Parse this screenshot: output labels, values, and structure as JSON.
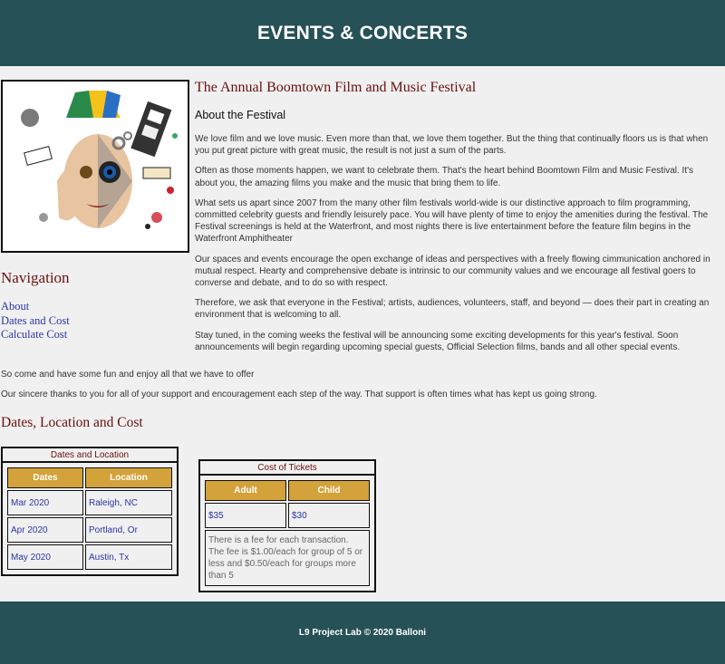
{
  "header": {
    "title": "EVENTS & CONCERTS"
  },
  "hero": {
    "image_label": "Festival collage"
  },
  "navigation": {
    "title": "Navigation",
    "links": [
      "About",
      "Dates and Cost",
      "Calculate Cost"
    ]
  },
  "main": {
    "title": "The Annual Boomtown Film and Music Festival",
    "subtitle": "About the Festival",
    "paragraphs": [
      "We love film and we love music. Even more than that, we love them together. But the thing that continually floors us is that when you put great picture with great music, the result is not just a sum of the parts.",
      "Often as those moments happen, we want to celebrate them. That's the heart behind Boomtown Film and Music Festival. It's about you, the amazing films you make and the music that bring them to life.",
      "What sets us apart since 2007 from the many other film festivals world-wide is our distinctive approach to film programming, committed celebrity guests and friendly leisurely pace. You will have plenty of time to enjoy the amenities during the festival. The Festival screenings is held at the Waterfront, and most nights there is live entertainment before the feature film begins in the Waterfront Amphitheater",
      "Our spaces and events encourage the open exchange of ideas and perspectives with a freely flowing cimmunication anchored in mutual respect. Hearty and comprehensive debate is intrinsic to our community values and we encourage all festival goers to converse and debate, and to do so with respect.",
      "Therefore, we ask that everyone in the Festival; artists, audiences, volunteers, staff, and beyond — does their part in creating an environment that is welcoming to all.",
      "Stay tuned, in the coming weeks the festival will be announcing some exciting developments for this year's festival. Soon announcements will begin regarding upcoming special guests, Official Selection films, bands and all other special events."
    ]
  },
  "outro": [
    "So come and have some fun and enjoy all that we have to offer",
    "Our sincere thanks to you for all of your support and encouragement each step of the way. That support is often times what has kept us going strong."
  ],
  "dates_section": {
    "title": "Dates, Location and Cost",
    "location_table": {
      "caption": "Dates and Location",
      "headers": [
        "Dates",
        "Location"
      ],
      "rows": [
        [
          "Mar 2020",
          "Raleigh, NC"
        ],
        [
          "Apr 2020",
          "Portland, Or"
        ],
        [
          "May 2020",
          "Austin, Tx"
        ]
      ]
    },
    "cost_table": {
      "caption": "Cost of Tickets",
      "headers": [
        "Adult",
        "Child"
      ],
      "prices": [
        "$35",
        "$30"
      ],
      "fee_note": "There is a fee for each transaction. The fee is $1.00/each for group of 5 or less and $0.50/each for groups more than 5"
    }
  },
  "footer": {
    "text": "L9 Project Lab © 2020 Balloni"
  },
  "colors": {
    "header_bg": "#265157",
    "heading": "#6a0f0f",
    "link": "#2b36a6",
    "table_header": "#d4a23a"
  }
}
